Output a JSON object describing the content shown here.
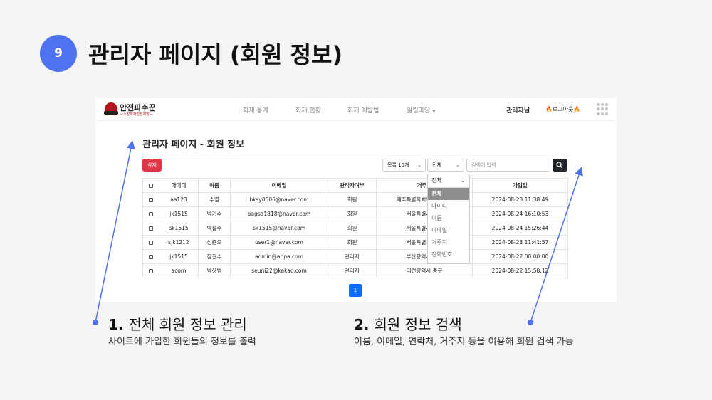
{
  "slide": {
    "number": "9",
    "title": "관리자 페이지 (회원 정보)"
  },
  "colors": {
    "accent": "#4f72f0",
    "danger": "#dc3545",
    "primary": "#0d6efd",
    "brand": "#b3161f"
  },
  "app": {
    "logo": {
      "name": "안전파수꾼",
      "subtitle": "—소방화재안전예방—"
    },
    "nav": {
      "links": [
        "화재 통계",
        "화재 현황",
        "화재 예방법",
        "알림마당"
      ],
      "user": "관리자님",
      "logout": "로그아웃"
    },
    "page_title": "관리자 페이지 - 회원 정보",
    "toolbar": {
      "delete_label": "삭제",
      "page_size": "목록 10개",
      "filter": "전체",
      "search_placeholder": "검색어 입력",
      "search_icon": "search-icon"
    },
    "table": {
      "headers": [
        "아이디",
        "이름",
        "이메일",
        "관리자여부",
        "거주지",
        "가입일"
      ],
      "rows": [
        [
          "aa123",
          "수영",
          "bksy0506@naver.com",
          "회원",
          "제주특별자치도 서귀포시",
          "2024-08-23 11:38:49"
        ],
        [
          "jk1515",
          "박기수",
          "bagsa1818@naver.com",
          "회원",
          "서울특별시 중구",
          "2024-08-24 16:10:53"
        ],
        [
          "sk1515",
          "박철수",
          "sk1515@naver.com",
          "회원",
          "서울특별시 중구",
          "2024-08-24 15:26:44"
        ],
        [
          "sjk1212",
          "성준오",
          "user1@naver.com",
          "회원",
          "서울특별시 중구",
          "2024-08-23 11:41:57"
        ],
        [
          "jk1515",
          "장길수",
          "admin@anpa.com",
          "관리자",
          "부산광역시 중구",
          "2024-08-22 00:00:00"
        ],
        [
          "acorn",
          "박상범",
          "seuni22@kakao.com",
          "관리자",
          "대전광역시 중구",
          "2024-08-22 15:58:12"
        ]
      ]
    },
    "dropdown": {
      "selected": "전체",
      "options": [
        "전체",
        "아이디",
        "이름",
        "이메일",
        "거주지",
        "전화번호"
      ]
    },
    "pagination": {
      "current": "1"
    }
  },
  "annotations": [
    {
      "number": "1.",
      "title": "전체 회원 정보 관리",
      "desc": "사이트에 가입한 회원들의 정보를 출력"
    },
    {
      "number": "2.",
      "title": "회원 정보 검색",
      "desc": "이름, 이메일, 연락처, 거주지 등을 이용해 회원 검색 가능"
    }
  ]
}
